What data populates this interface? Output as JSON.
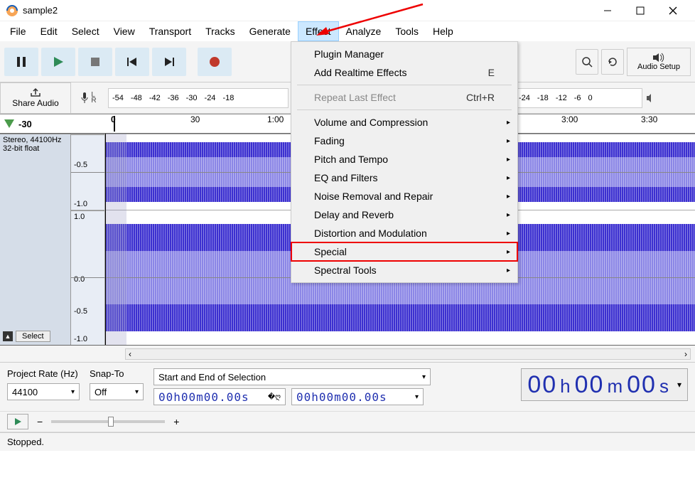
{
  "window": {
    "title": "sample2"
  },
  "menu": {
    "items": [
      "File",
      "Edit",
      "Select",
      "View",
      "Transport",
      "Tracks",
      "Generate",
      "Effect",
      "Analyze",
      "Tools",
      "Help"
    ],
    "active_index": 7
  },
  "effect_menu": {
    "plugin_manager": "Plugin Manager",
    "add_realtime": "Add Realtime Effects",
    "add_realtime_shortcut": "E",
    "repeat_last": "Repeat Last Effect",
    "repeat_last_shortcut": "Ctrl+R",
    "submenus": [
      "Volume and Compression",
      "Fading",
      "Pitch and Tempo",
      "EQ and Filters",
      "Noise Removal and Repair",
      "Delay and Reverb",
      "Distortion and Modulation",
      "Special",
      "Spectral Tools"
    ],
    "highlight_index": 7
  },
  "toolbar": {
    "audio_setup": "Audio Setup"
  },
  "share": {
    "label": "Share Audio"
  },
  "meter": {
    "lr": [
      "L",
      "R"
    ],
    "ticks": [
      "-54",
      "-48",
      "-42",
      "-36",
      "-30",
      "-24",
      "-18"
    ],
    "ticks_right": [
      "-24",
      "-18",
      "-12",
      "-6",
      "0"
    ]
  },
  "ruler": {
    "left_label": "-30",
    "ticks": [
      {
        "pos": 60,
        "label": "0"
      },
      {
        "pos": 172,
        "label": "30"
      },
      {
        "pos": 284,
        "label": "1:00"
      },
      {
        "pos": 698,
        "label": "3:00"
      },
      {
        "pos": 810,
        "label": "3:30"
      }
    ]
  },
  "track": {
    "info1": "Stereo, 44100Hz",
    "info2": "32-bit float",
    "scale": [
      "-0.5",
      "-1.0",
      "1.0",
      "0.0",
      "-0.5",
      "-1.0"
    ],
    "select_btn": "Select"
  },
  "bottom": {
    "project_rate_lbl": "Project Rate (Hz)",
    "project_rate_val": "44100",
    "snap_lbl": "Snap-To",
    "snap_val": "Off",
    "selection_lbl": "Start and End of Selection",
    "time1": "00h00m00.00s",
    "time2": "00h00m00.00s",
    "big_time": [
      "00",
      "h",
      "00",
      "m",
      "00",
      "s"
    ]
  },
  "status": {
    "text": "Stopped."
  }
}
